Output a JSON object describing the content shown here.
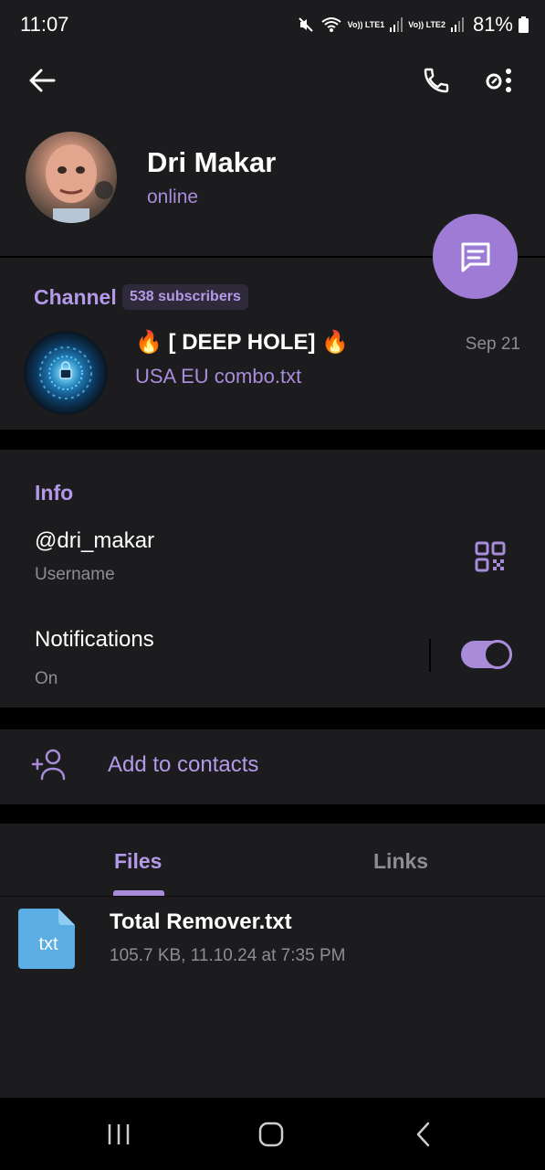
{
  "status_bar": {
    "time": "11:07",
    "battery": "81%",
    "network1": "Vo)) LTE1",
    "network2": "Vo)) LTE2"
  },
  "toolbar": {
    "back_icon": "arrow-left-icon",
    "call_icon": "phone-icon",
    "more_icon": "more-vertical-icon"
  },
  "profile": {
    "name": "Dri Makar",
    "status": "online"
  },
  "fab": {
    "icon": "message-icon"
  },
  "channel": {
    "label": "Channel",
    "subscribers": "538 subscribers",
    "title": "🔥 [ DEEP HOLE] 🔥",
    "last_message": "USA EU combo.txt",
    "date": "Sep 21"
  },
  "info": {
    "label": "Info",
    "username": "@dri_makar",
    "username_caption": "Username",
    "notifications_title": "Notifications",
    "notifications_value": "On",
    "notifications_enabled": true
  },
  "contacts": {
    "add_label": "Add to contacts"
  },
  "tabs": {
    "items": [
      {
        "label": "Files",
        "active": true
      },
      {
        "label": "Links",
        "active": false
      }
    ]
  },
  "files": [
    {
      "icon_label": "txt",
      "name": "Total Remover.txt",
      "meta": "105.7 KB, 11.10.24 at 7:35 PM"
    }
  ],
  "colors": {
    "accent": "#a88cda",
    "background": "#1c1c1e",
    "secondary_text": "#8d8d93"
  }
}
